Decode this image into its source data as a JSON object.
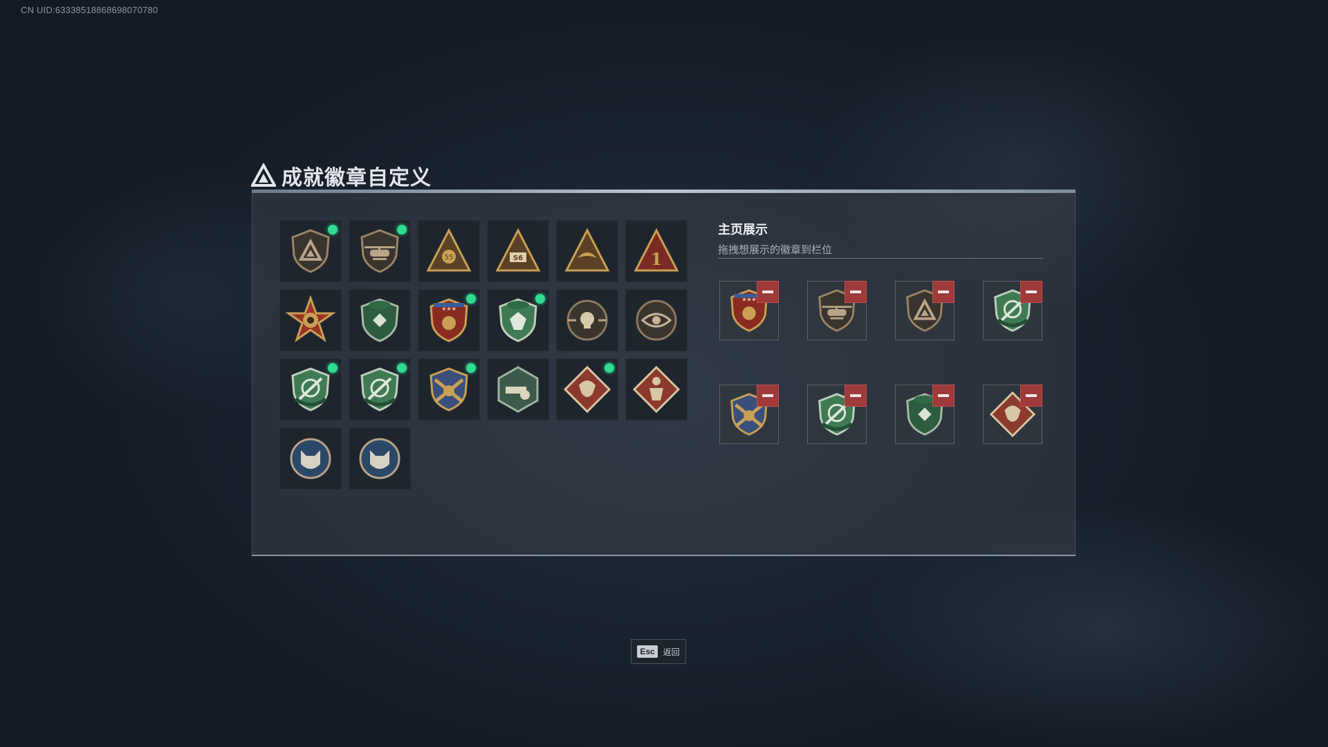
{
  "uid": "CN UID:63338518868698070780",
  "title": "成就徽章自定义",
  "colors": {
    "new_dot": "#2fdc92",
    "remove": "#9e3a3a",
    "accent_bar": "#b8c7d6"
  },
  "badges": [
    {
      "icon": "shield-triangle-badge-icon",
      "new": true
    },
    {
      "icon": "helicopter-shield-badge-icon",
      "new": true
    },
    {
      "icon": "gold-triangle-badge-icon",
      "new": false
    },
    {
      "icon": "s6-triangle-badge-icon",
      "new": false
    },
    {
      "icon": "gold-bird-triangle-badge-icon",
      "new": false
    },
    {
      "icon": "number-one-triangle-badge-icon",
      "new": false
    },
    {
      "icon": "star-eagle-badge-icon",
      "new": false
    },
    {
      "icon": "green-beret-shield-badge-icon",
      "new": false
    },
    {
      "icon": "red-eagle-stars-badge-icon",
      "new": true
    },
    {
      "icon": "green-gem-shield-badge-icon",
      "new": true
    },
    {
      "icon": "skull-crosshair-badge-icon",
      "new": false
    },
    {
      "icon": "eye-circle-badge-icon",
      "new": false
    },
    {
      "icon": "green-rifle-shield-badge-icon",
      "new": true
    },
    {
      "icon": "green-rifle-shield-badge-icon",
      "new": true
    },
    {
      "icon": "gold-crossed-rifles-badge-icon",
      "new": true
    },
    {
      "icon": "hexagon-cannon-badge-icon",
      "new": false
    },
    {
      "icon": "dragon-diamond-badge-icon",
      "new": true
    },
    {
      "icon": "soldier-diamond-badge-icon",
      "new": false
    },
    {
      "icon": "blue-wolf-badge-icon",
      "new": false
    },
    {
      "icon": "blue-wolf-badge-icon",
      "new": false
    }
  ],
  "showcase": {
    "title": "主页展示",
    "subtitle": "拖拽想展示的徽章到栏位",
    "slots": [
      {
        "icon": "red-eagle-stars-badge-icon"
      },
      {
        "icon": "helicopter-shield-badge-icon"
      },
      {
        "icon": "shield-triangle-badge-icon"
      },
      {
        "icon": "green-rifle-shield-badge-icon"
      },
      {
        "icon": "gold-crossed-rifles-badge-icon"
      },
      {
        "icon": "green-rifle-shield-badge-icon"
      },
      {
        "icon": "green-beret-shield-badge-icon"
      },
      {
        "icon": "dragon-diamond-badge-icon"
      }
    ]
  },
  "footer": {
    "key": "Esc",
    "label": "返回"
  }
}
